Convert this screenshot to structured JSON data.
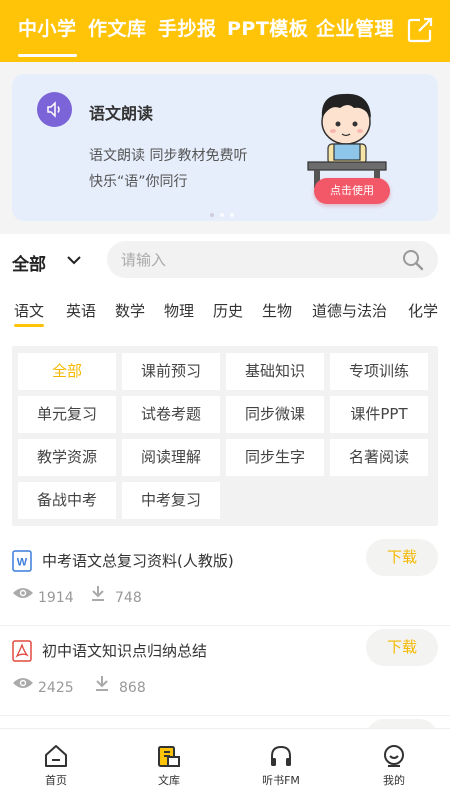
{
  "top_tabs": [
    "中小学",
    "作文库",
    "手抄报",
    "PPT模板",
    "企业管理"
  ],
  "banner": {
    "title": "语文朗读",
    "line1": "语文朗读 同步教材免费听",
    "line2": "快乐“语”你同行",
    "button": "点击使用"
  },
  "filter": {
    "scope": "全部",
    "search_placeholder": "请输入"
  },
  "subjects": [
    "语文",
    "英语",
    "数学",
    "物理",
    "历史",
    "生物",
    "道德与法治",
    "化学"
  ],
  "categories": [
    "全部",
    "课前预习",
    "基础知识",
    "专项训练",
    "单元复习",
    "试卷考题",
    "同步微课",
    "课件PPT",
    "教学资源",
    "阅读理解",
    "同步生字",
    "名著阅读",
    "备战中考",
    "中考复习"
  ],
  "documents": [
    {
      "title": "中考语文总复习资料(人教版)",
      "type": "word",
      "views": "1914",
      "downloads": "748",
      "button": "下载"
    },
    {
      "title": "初中语文知识点归纳总结",
      "type": "pdf",
      "views": "2425",
      "downloads": "868",
      "button": "下载"
    }
  ],
  "bottom_nav": [
    "首页",
    "文库",
    "听书FM",
    "我的"
  ],
  "colors": {
    "accent": "#FFC408",
    "download_text": "#F5B800",
    "banner_bg": "#E6EEFC",
    "button_red": "#F25868"
  }
}
